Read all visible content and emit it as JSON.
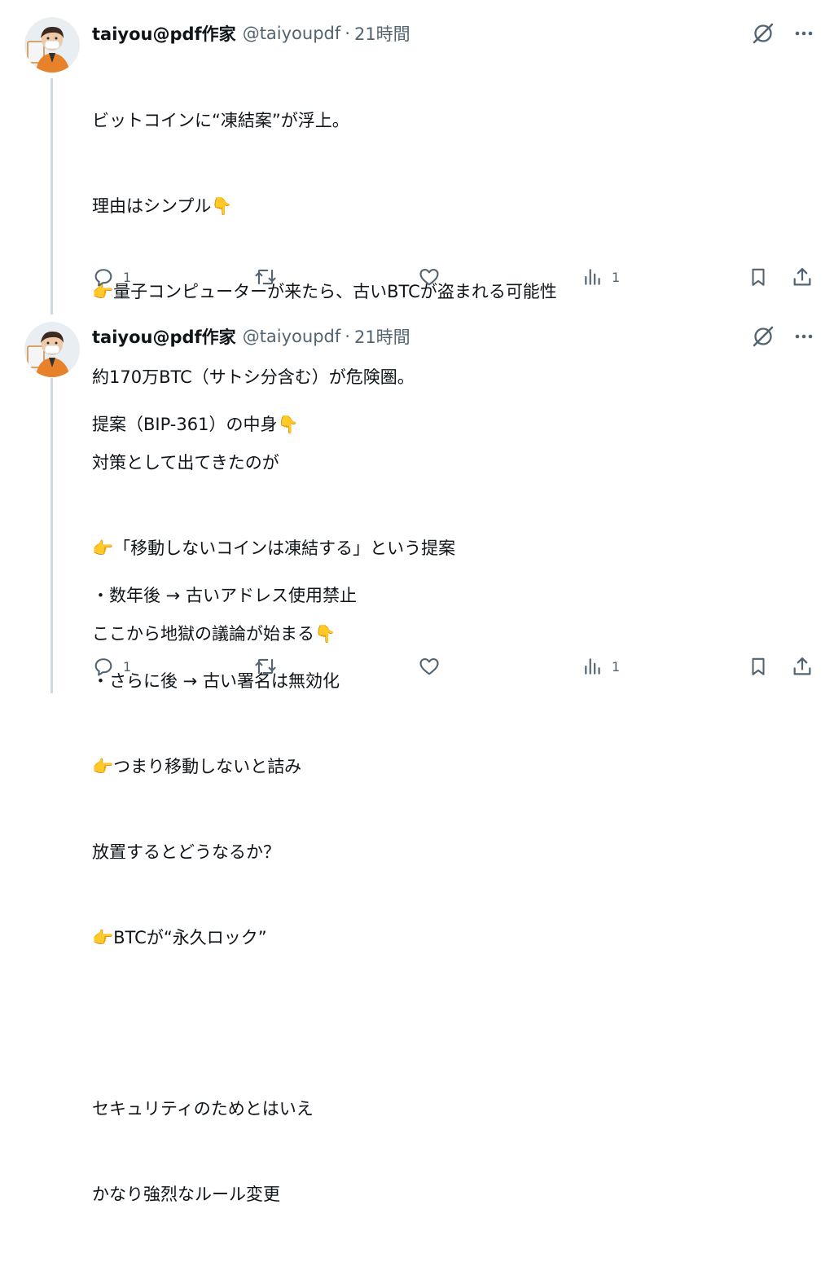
{
  "tweets": [
    {
      "name": "taiyou@pdf作家",
      "handle": "@taiyoupdf",
      "separator": "·",
      "time": "21時間",
      "lines": [
        "ビットコインに“凍結案”が浮上。",
        "理由はシンプル👇",
        "👉量子コンピューターが来たら、古いBTCが盗まれる可能性",
        "約170万BTC（サトシ分含む）が危険圏。",
        "対策として出てきたのが",
        "👉「移動しないコインは凍結する」という提案",
        "ここから地獄の議論が始まる👇"
      ],
      "reply_count": "1",
      "view_count": "1"
    },
    {
      "name": "taiyou@pdf作家",
      "handle": "@taiyoupdf",
      "separator": "·",
      "time": "21時間",
      "lines": [
        "提案（BIP-361）の中身👇",
        "",
        "・数年後 → 古いアドレス使用禁止",
        "・さらに後 → 古い署名は無効化",
        "👉つまり移動しないと詰み",
        "放置するとどうなるか？",
        "👉BTCが“永久ロック”",
        "",
        "セキュリティのためとはいえ",
        "かなり強烈なルール変更"
      ],
      "reply_count": "1",
      "view_count": "1"
    }
  ],
  "icons": {
    "grok": "grok-slash-icon",
    "more": "more-icon",
    "reply": "reply-icon",
    "repost": "repost-icon",
    "like": "heart-icon",
    "views": "views-icon",
    "bookmark": "bookmark-icon",
    "share": "share-icon"
  },
  "colors": {
    "text": "#0f1419",
    "muted": "#536471",
    "thread_line": "#cfd9de"
  }
}
